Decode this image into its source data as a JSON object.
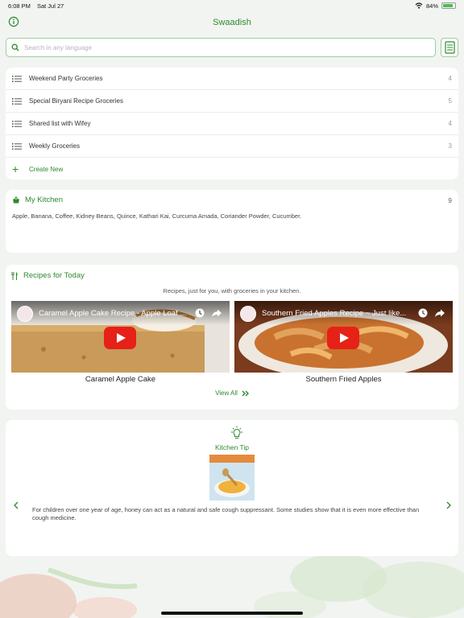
{
  "status_bar": {
    "time": "6:08 PM",
    "date": "Sat Jul 27",
    "battery": "84%",
    "battery_level": 0.84
  },
  "app": {
    "title": "Swaadish"
  },
  "search": {
    "placeholder": "Search in any language"
  },
  "lists": {
    "items": [
      {
        "name": "Weekend Party Groceries",
        "count": "4"
      },
      {
        "name": "Special Biryani Recipe Groceries",
        "count": "5"
      },
      {
        "name": "Shared list with Wifey",
        "count": "4"
      },
      {
        "name": "Weekly Groceries",
        "count": "3"
      }
    ],
    "create_label": "Create New"
  },
  "kitchen": {
    "title": "My Kitchen",
    "count": "9",
    "items": "Apple, Banana, Coffee, Kidney Beans, Quince, Kathari Kai, Curcuma Amada, Coriander Powder, Cucumber."
  },
  "recipes": {
    "title": "Recipes for Today",
    "subtitle": "Recipes, just for you, with groceries in your kitchen.",
    "videos": [
      {
        "video_title": "Caramel Apple Cake Recipe - Apple Loaf ...",
        "caption": "Caramel Apple Cake"
      },
      {
        "video_title": "Southern Fried Apples Recipe ~ Just like...",
        "caption": "Southern Fried Apples"
      }
    ],
    "view_all": "View All"
  },
  "tip": {
    "title": "Kitchen Tip",
    "text": "For children over one year of age, honey can act as a natural and safe cough suppressant. Some studies show that it is even more effective than cough medicine."
  },
  "colors": {
    "accent": "#2c8a2c",
    "background": "#f2f4f2",
    "youtube_red": "#e62117"
  }
}
